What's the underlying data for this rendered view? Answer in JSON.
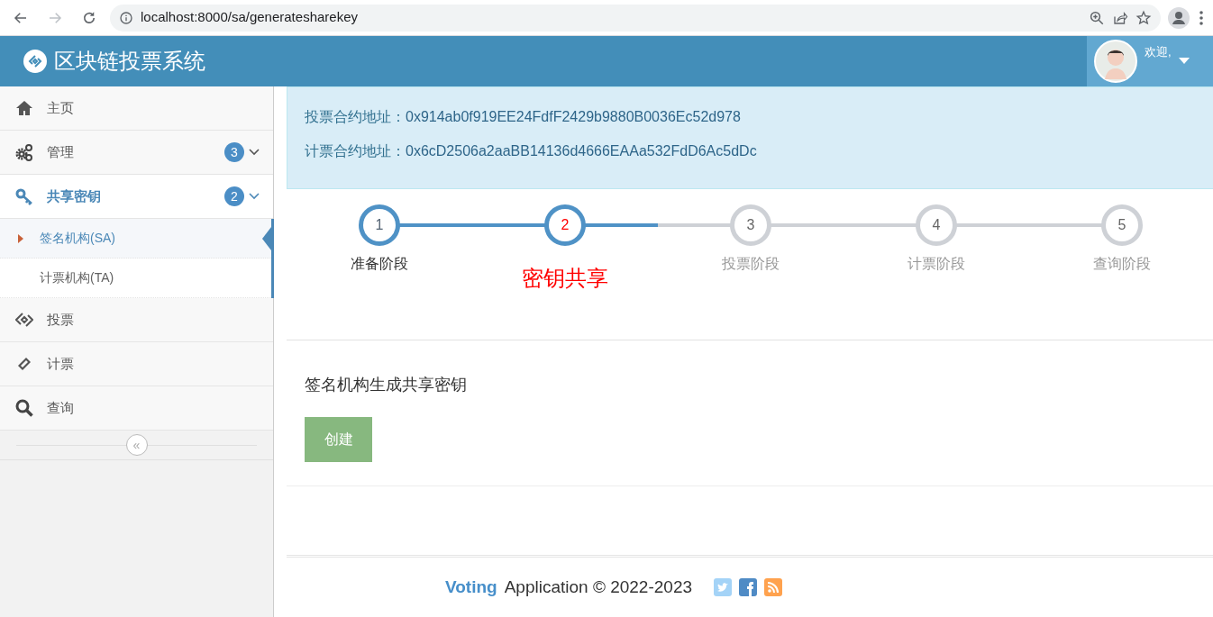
{
  "browser": {
    "url": "localhost:8000/sa/generatesharekey",
    "back_disabled": false,
    "forward_disabled": true
  },
  "header": {
    "title": "区块链投票系统",
    "greeting": "欢迎,"
  },
  "sidebar": {
    "items": [
      {
        "label": "主页",
        "selected": false
      },
      {
        "label": "管理",
        "badge": "3",
        "selected": false,
        "expanded": false
      },
      {
        "label": "共享密钥",
        "badge": "2",
        "selected": true,
        "expanded": true,
        "children": [
          {
            "label": "签名机构(SA)",
            "selected": true
          },
          {
            "label": "计票机构(TA)",
            "selected": false
          }
        ]
      },
      {
        "label": "投票",
        "selected": false
      },
      {
        "label": "计票",
        "selected": false
      },
      {
        "label": "查询",
        "selected": false
      }
    ],
    "collapse_button": "«"
  },
  "contracts": [
    {
      "label": "投票合约地址：",
      "value": "0x914ab0f919EE24FdfF2429b9880B0036Ec52d978"
    },
    {
      "label": "计票合约地址：",
      "value": "0x6cD2506a2aaBB14136d4666EAAa532FdD6Ac5dDc"
    }
  ],
  "steps": [
    {
      "number": "1",
      "label": "准备阶段",
      "complete": true,
      "selected": false
    },
    {
      "number": "2",
      "label": "密钥共享",
      "complete": true,
      "selected": true
    },
    {
      "number": "3",
      "label": "投票阶段",
      "complete": false,
      "selected": false
    },
    {
      "number": "4",
      "label": "计票阶段",
      "complete": false,
      "selected": false
    },
    {
      "number": "5",
      "label": "查询阶段",
      "complete": false,
      "selected": false
    }
  ],
  "task": {
    "text": "签名机构生成共享密钥",
    "button": "创建"
  },
  "footer": {
    "brand": "Voting",
    "text": "Application © 2022-2023"
  }
}
